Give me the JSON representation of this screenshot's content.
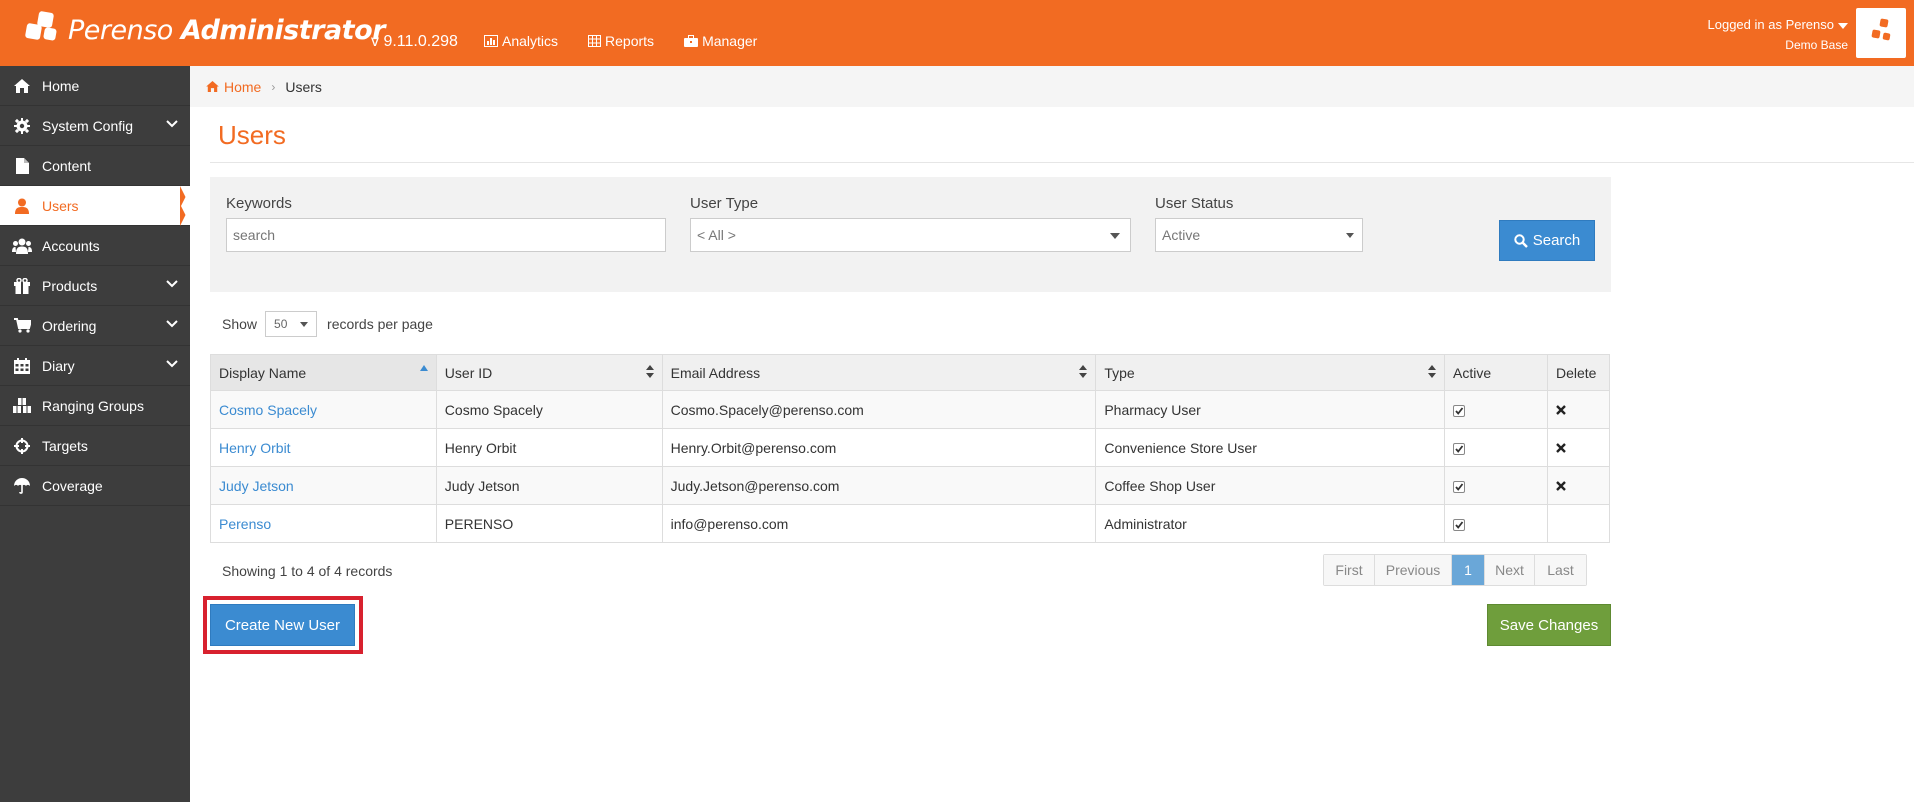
{
  "header": {
    "brand_name": "Perenso",
    "brand_suffix": "Administrator",
    "version": "v 9.11.0.298",
    "nav": [
      {
        "label": "Analytics",
        "icon": "chart-icon"
      },
      {
        "label": "Reports",
        "icon": "table-icon"
      },
      {
        "label": "Manager",
        "icon": "briefcase-icon"
      }
    ],
    "user_label": "Logged in as Perenso",
    "database": "Demo Base",
    "accent_color": "#f26b22"
  },
  "sidebar": {
    "items": [
      {
        "label": "Home",
        "icon": "home-icon",
        "expandable": false
      },
      {
        "label": "System Config",
        "icon": "gear-icon",
        "expandable": true
      },
      {
        "label": "Content",
        "icon": "file-icon",
        "expandable": false
      },
      {
        "label": "Users",
        "icon": "user-icon",
        "expandable": false,
        "active": true
      },
      {
        "label": "Accounts",
        "icon": "users-icon",
        "expandable": false
      },
      {
        "label": "Products",
        "icon": "gift-icon",
        "expandable": true
      },
      {
        "label": "Ordering",
        "icon": "cart-icon",
        "expandable": true
      },
      {
        "label": "Diary",
        "icon": "calendar-icon",
        "expandable": true
      },
      {
        "label": "Ranging Groups",
        "icon": "cubes-icon",
        "expandable": false
      },
      {
        "label": "Targets",
        "icon": "crosshairs-icon",
        "expandable": false
      },
      {
        "label": "Coverage",
        "icon": "umbrella-icon",
        "expandable": false
      }
    ]
  },
  "breadcrumb": {
    "home": "Home",
    "current": "Users"
  },
  "page": {
    "title": "Users"
  },
  "filters": {
    "keywords_label": "Keywords",
    "keywords_placeholder": "search",
    "user_type_label": "User Type",
    "user_type_value": "< All >",
    "user_status_label": "User Status",
    "user_status_value": "Active",
    "search_button": "Search"
  },
  "paging_controls": {
    "show": "Show",
    "per_page": "50",
    "per_page_suffix": "records per page"
  },
  "table": {
    "columns": [
      "Display Name",
      "User ID",
      "Email Address",
      "Type",
      "Active",
      "Delete"
    ],
    "rows": [
      {
        "display_name": "Cosmo Spacely",
        "user_id": "Cosmo Spacely",
        "email": "Cosmo.Spacely@perenso.com",
        "type": "Pharmacy User",
        "active": true,
        "deletable": true
      },
      {
        "display_name": "Henry Orbit",
        "user_id": "Henry Orbit",
        "email": "Henry.Orbit@perenso.com",
        "type": "Convenience Store User",
        "active": true,
        "deletable": true
      },
      {
        "display_name": "Judy Jetson",
        "user_id": "Judy Jetson",
        "email": "Judy.Jetson@perenso.com",
        "type": "Coffee Shop User",
        "active": true,
        "deletable": true
      },
      {
        "display_name": "Perenso",
        "user_id": "PERENSO",
        "email": "info@perenso.com",
        "type": "Administrator",
        "active": true,
        "deletable": false
      }
    ]
  },
  "records_info": "Showing 1 to 4 of 4 records",
  "pagination": {
    "first": "First",
    "previous": "Previous",
    "current": "1",
    "next": "Next",
    "last": "Last"
  },
  "actions": {
    "create": "Create New User",
    "save": "Save Changes"
  }
}
